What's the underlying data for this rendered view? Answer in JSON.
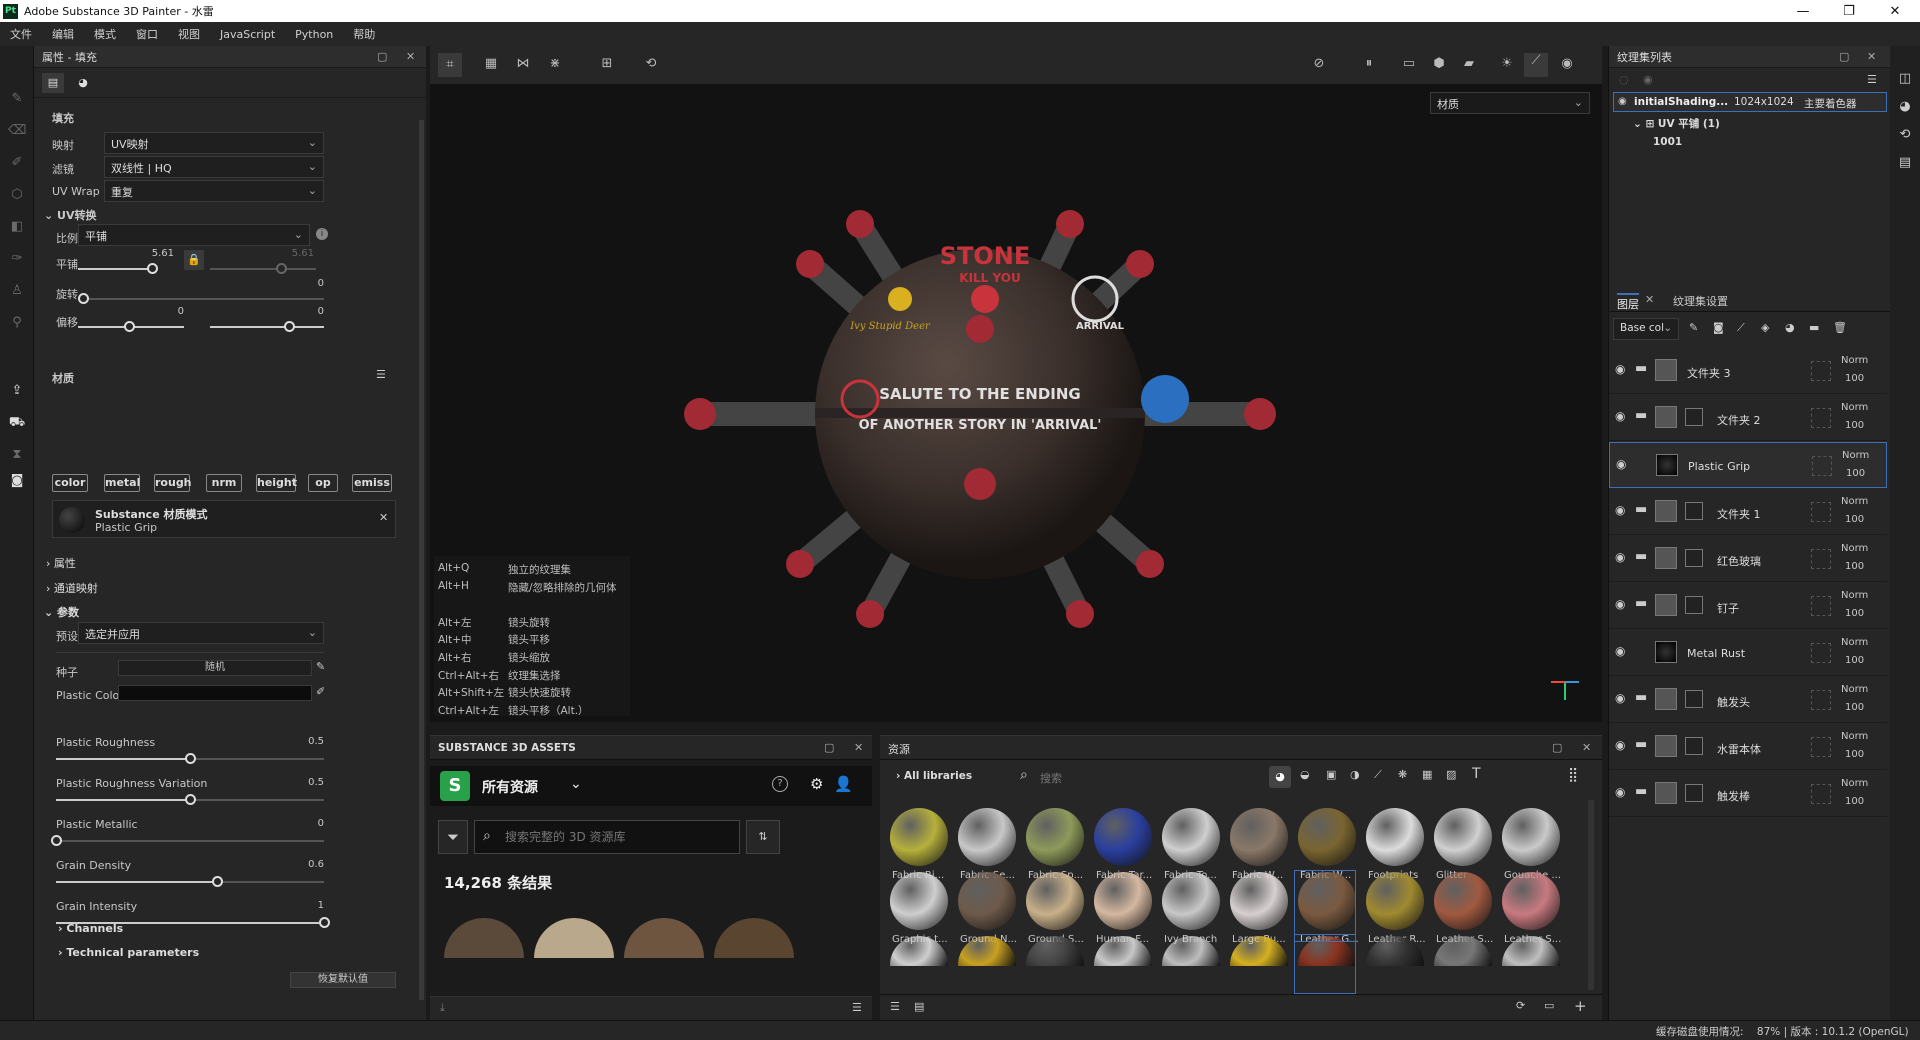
{
  "window": {
    "title": "Adobe Substance 3D Painter - 水雷",
    "logo": "Pt"
  },
  "menu": [
    "文件",
    "编辑",
    "模式",
    "窗口",
    "视图",
    "JavaScript",
    "Python",
    "帮助"
  ],
  "properties": {
    "header": "属性 - 填充",
    "fill_label": "填充",
    "mapping": {
      "label": "映射",
      "value": "UV映射"
    },
    "filter": {
      "label": "滤镜",
      "value": "双线性 | HQ"
    },
    "uvwrap": {
      "label": "UV Wrap",
      "value": "重复"
    },
    "uv_transform": "UV转换",
    "scale": {
      "label": "比例",
      "value": "平铺"
    },
    "tiling": {
      "label": "平铺",
      "value": "5.61",
      "value2": "5.61"
    },
    "rotation": {
      "label": "旋转",
      "value": "0"
    },
    "offset": {
      "label": "偏移",
      "value": "0",
      "value2": "0"
    },
    "material_label": "材质",
    "channels": [
      "color",
      "metal",
      "rough",
      "nrm",
      "height",
      "op",
      "emiss"
    ],
    "material_mode": {
      "title": "Substance 材质模式",
      "name": "Plastic Grip"
    },
    "attributes": "属性",
    "channel_map": "通道映射",
    "params": "参数",
    "preset": {
      "label": "预设",
      "value": "选定并应用"
    },
    "seed": {
      "label": "种子",
      "value": "随机"
    },
    "plastic_color": "Plastic Color",
    "sliders": [
      {
        "label": "Plastic Roughness",
        "value": "0.5",
        "pos": 0.5
      },
      {
        "label": "Plastic Roughness Variation",
        "value": "0.5",
        "pos": 0.5
      },
      {
        "label": "Plastic Metallic",
        "value": "0",
        "pos": 0
      },
      {
        "label": "Grain Density",
        "value": "0.6",
        "pos": 0.6
      },
      {
        "label": "Grain Intensity",
        "value": "1",
        "pos": 1
      }
    ],
    "channels_section": "Channels",
    "technical": "Technical parameters",
    "bottom_btn": "恢复默认值"
  },
  "viewport": {
    "dropdown": "材质",
    "texts": {
      "stone": "STONE",
      "kill": "KILL YOU",
      "salute1": "SALUTE TO THE ENDING",
      "salute2": "OF ANOTHER STORY IN 'ARRIVAL'",
      "arrival": "ARRIVAL",
      "sig": "Ivy Stupid Deer"
    },
    "shortcuts": [
      [
        "Alt+Q",
        "独立的纹理集"
      ],
      [
        "Alt+H",
        "隐藏/忽略排除的几何体"
      ],
      [
        "",
        ""
      ],
      [
        "Alt+左",
        "镜头旋转"
      ],
      [
        "Alt+中",
        "镜头平移"
      ],
      [
        "Alt+右",
        "镜头缩放"
      ],
      [
        "Ctrl+Alt+右",
        "纹理集选择"
      ],
      [
        "Alt+Shift+左",
        "镜头快速旋转"
      ],
      [
        "Ctrl+Alt+左",
        "镜头平移（Alt.）"
      ]
    ]
  },
  "assets": {
    "header": "SUBSTANCE 3D ASSETS",
    "dropdown": "所有资源",
    "search_placeholder": "搜索完整的 3D 资源库",
    "results": "14,268 条结果"
  },
  "resources": {
    "header": "资源",
    "breadcrumb": "All libraries",
    "search_placeholder": "搜索",
    "row1": [
      "Fabric Ri...",
      "Fabric Se...",
      "Fabric Sp...",
      "Fabric Tar...",
      "Fabric To...",
      "Fabric W...",
      "Fabric W...",
      "Footprints",
      "Glitter",
      "Gouache ..."
    ],
    "row2": [
      "Graphic t...",
      "Ground N...",
      "Ground S...",
      "Human F...",
      "Ivy Branch",
      "Large Ru...",
      "Leather G...",
      "Leather R...",
      "Leather S...",
      "Leather S..."
    ]
  },
  "textureset": {
    "header": "纹理集列表",
    "item": {
      "name": "initialShading...",
      "size": "1024x1024",
      "shader": "主要着色器"
    },
    "uv": "UV 平铺 (1)",
    "tile": "1001"
  },
  "layers": {
    "tab1": "图层",
    "tab2": "纹理集设置",
    "channel_select": "Base col",
    "items": [
      {
        "name": "文件夹 3",
        "blend": "Norm",
        "opacity": "100"
      },
      {
        "name": "文件夹 2",
        "blend": "Norm",
        "opacity": "100"
      },
      {
        "name": "Plastic Grip",
        "blend": "Norm",
        "opacity": "100"
      },
      {
        "name": "文件夹 1",
        "blend": "Norm",
        "opacity": "100"
      },
      {
        "name": "红色玻璃",
        "blend": "Norm",
        "opacity": "100"
      },
      {
        "name": "钉子",
        "blend": "Norm",
        "opacity": "100"
      },
      {
        "name": "Metal Rust",
        "blend": "Norm",
        "opacity": "100"
      },
      {
        "name": "触发头",
        "blend": "Norm",
        "opacity": "100"
      },
      {
        "name": "水雷本体",
        "blend": "Norm",
        "opacity": "100"
      },
      {
        "name": "触发棒",
        "blend": "Norm",
        "opacity": "100"
      }
    ]
  },
  "status": "缓存磁盘使用情况:    87% | 版本 : 10.1.2 (OpenGL)"
}
